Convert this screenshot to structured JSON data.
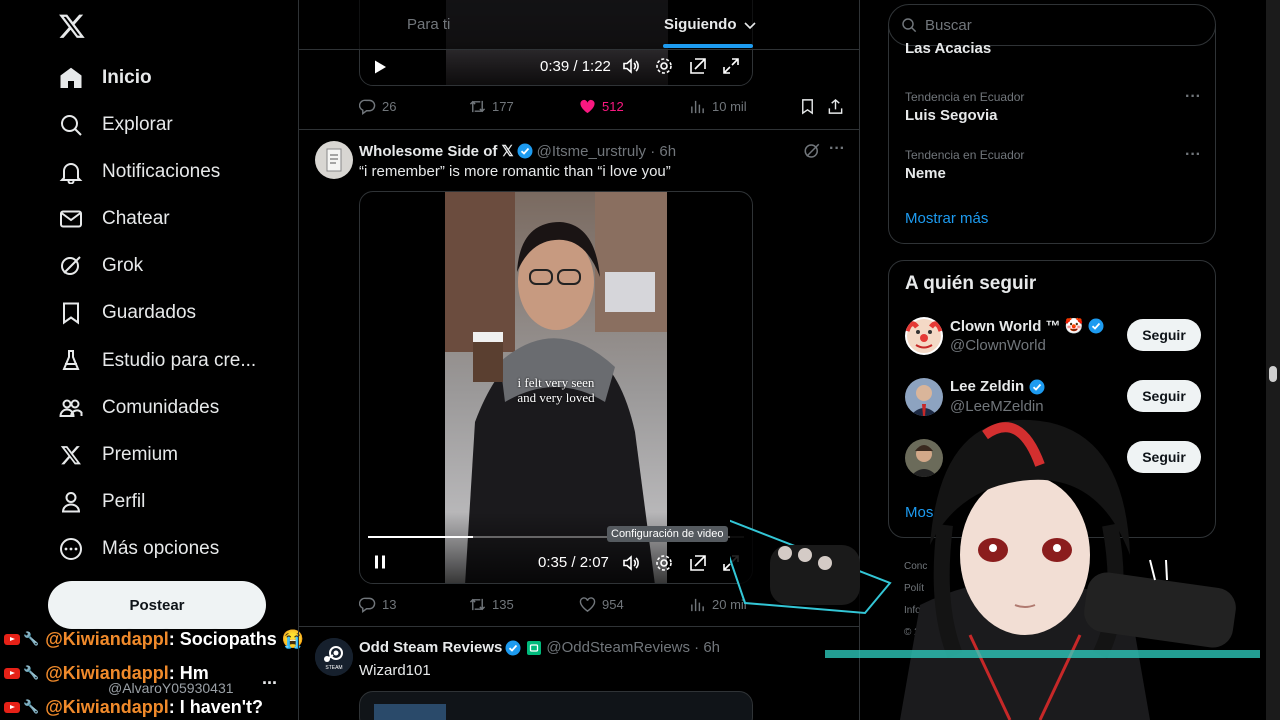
{
  "sidebar": {
    "nav": [
      {
        "label": "Inicio",
        "icon": "home-icon"
      },
      {
        "label": "Explorar",
        "icon": "search-icon"
      },
      {
        "label": "Notificaciones",
        "icon": "bell-icon"
      },
      {
        "label": "Chatear",
        "icon": "mail-icon"
      },
      {
        "label": "Grok",
        "icon": "grok-icon"
      },
      {
        "label": "Guardados",
        "icon": "bookmark-icon"
      },
      {
        "label": "Estudio para cre...",
        "icon": "flask-icon"
      },
      {
        "label": "Comunidades",
        "icon": "people-icon"
      },
      {
        "label": "Premium",
        "icon": "x-logo-icon"
      },
      {
        "label": "Perfil",
        "icon": "person-icon"
      },
      {
        "label": "Más opciones",
        "icon": "more-circle-icon"
      }
    ],
    "post_label": "Postear",
    "account_handle": "@AlvaroY05930431",
    "account_more": "..."
  },
  "chat": [
    {
      "user": "@Kiwiandappl",
      "message": ": Sociopaths 😭"
    },
    {
      "user": "@Kiwiandappl",
      "message": ": Hm"
    },
    {
      "user": "@Kiwiandappl",
      "message": ": I haven't?"
    }
  ],
  "main": {
    "tabs": {
      "for_you": "Para ti",
      "following": "Siguiendo"
    },
    "top_tweet": {
      "video_time": "0:39 / 1:22",
      "replies": "26",
      "reposts": "177",
      "likes": "512",
      "views": "10 mil"
    },
    "tweet1": {
      "name": "Wholesome Side of 𝕏",
      "handle": "@Itsme_urstruly · 6h",
      "text": "“i remember” is more romantic than “i love you”",
      "caption_line1": "i felt very seen",
      "caption_line2": "and very loved",
      "video_time": "0:35 / 2:07",
      "tooltip": "Configuración de video",
      "replies": "13",
      "reposts": "135",
      "likes": "954",
      "views": "20 mil",
      "progress_fraction": 0.28
    },
    "tweet2": {
      "name": "Odd Steam Reviews",
      "handle": "@OddSteamReviews · 6h",
      "text": "Wizard101",
      "avatar_label": "STEAM"
    }
  },
  "right": {
    "search_placeholder": "Buscar",
    "trends": [
      {
        "context": "",
        "name": "Las Acacias"
      },
      {
        "context": "Tendencia en Ecuador",
        "name": "Luis Segovia"
      },
      {
        "context": "Tendencia en Ecuador",
        "name": "Neme"
      }
    ],
    "show_more": "Mostrar más",
    "who_to_follow": {
      "title": "A quién seguir",
      "items": [
        {
          "name": "Clown World ™ 🤡",
          "handle": "@ClownWorld",
          "button": "Seguir"
        },
        {
          "name": "Lee Zeldin",
          "handle": "@LeeMZeldin",
          "button": "Seguir"
        },
        {
          "name": "",
          "handle": "",
          "button": "Seguir"
        }
      ],
      "show_more": "Mos"
    },
    "footer_fragments": [
      "Conc",
      "Polít",
      "Info",
      "© 2"
    ]
  },
  "colors": {
    "accent": "#1d9bf0",
    "like": "#f91880",
    "background": "#000000",
    "border": "#2f3336",
    "muted": "#71767b",
    "chat_user": "#f08a2b"
  }
}
